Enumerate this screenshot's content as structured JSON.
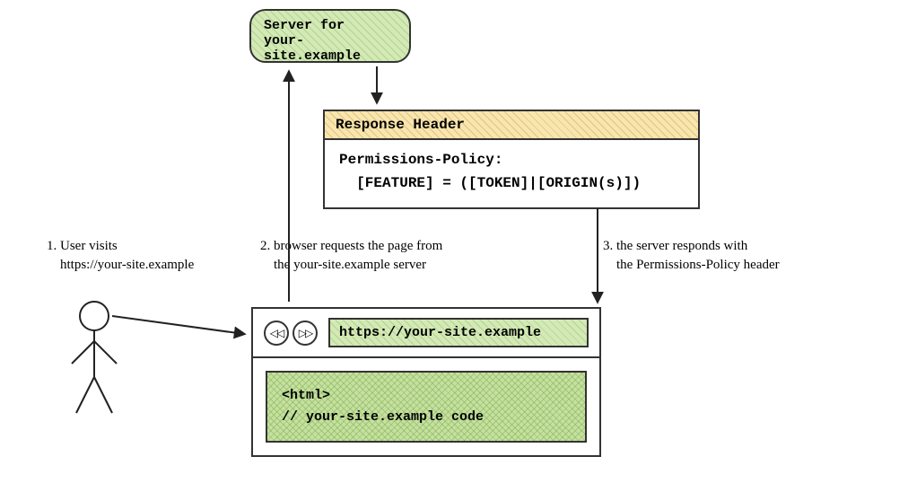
{
  "server": {
    "line1": "Server for",
    "line2": "your-site.example"
  },
  "response": {
    "header": "Response Header",
    "body": "Permissions-Policy:\n  [FEATURE] = ([TOKEN]|[ORIGIN(s)])"
  },
  "captions": {
    "step1": "1. User visits\n    https://your-site.example",
    "step2": "2. browser requests the page from\n    the your-site.example server",
    "step3": "3. the server responds with\n    the Permissions-Policy header"
  },
  "browser": {
    "back_glyph": "◁◁",
    "forward_glyph": "▷▷",
    "url": "https://your-site.example",
    "code": "<html>\n// your-site.example code"
  }
}
